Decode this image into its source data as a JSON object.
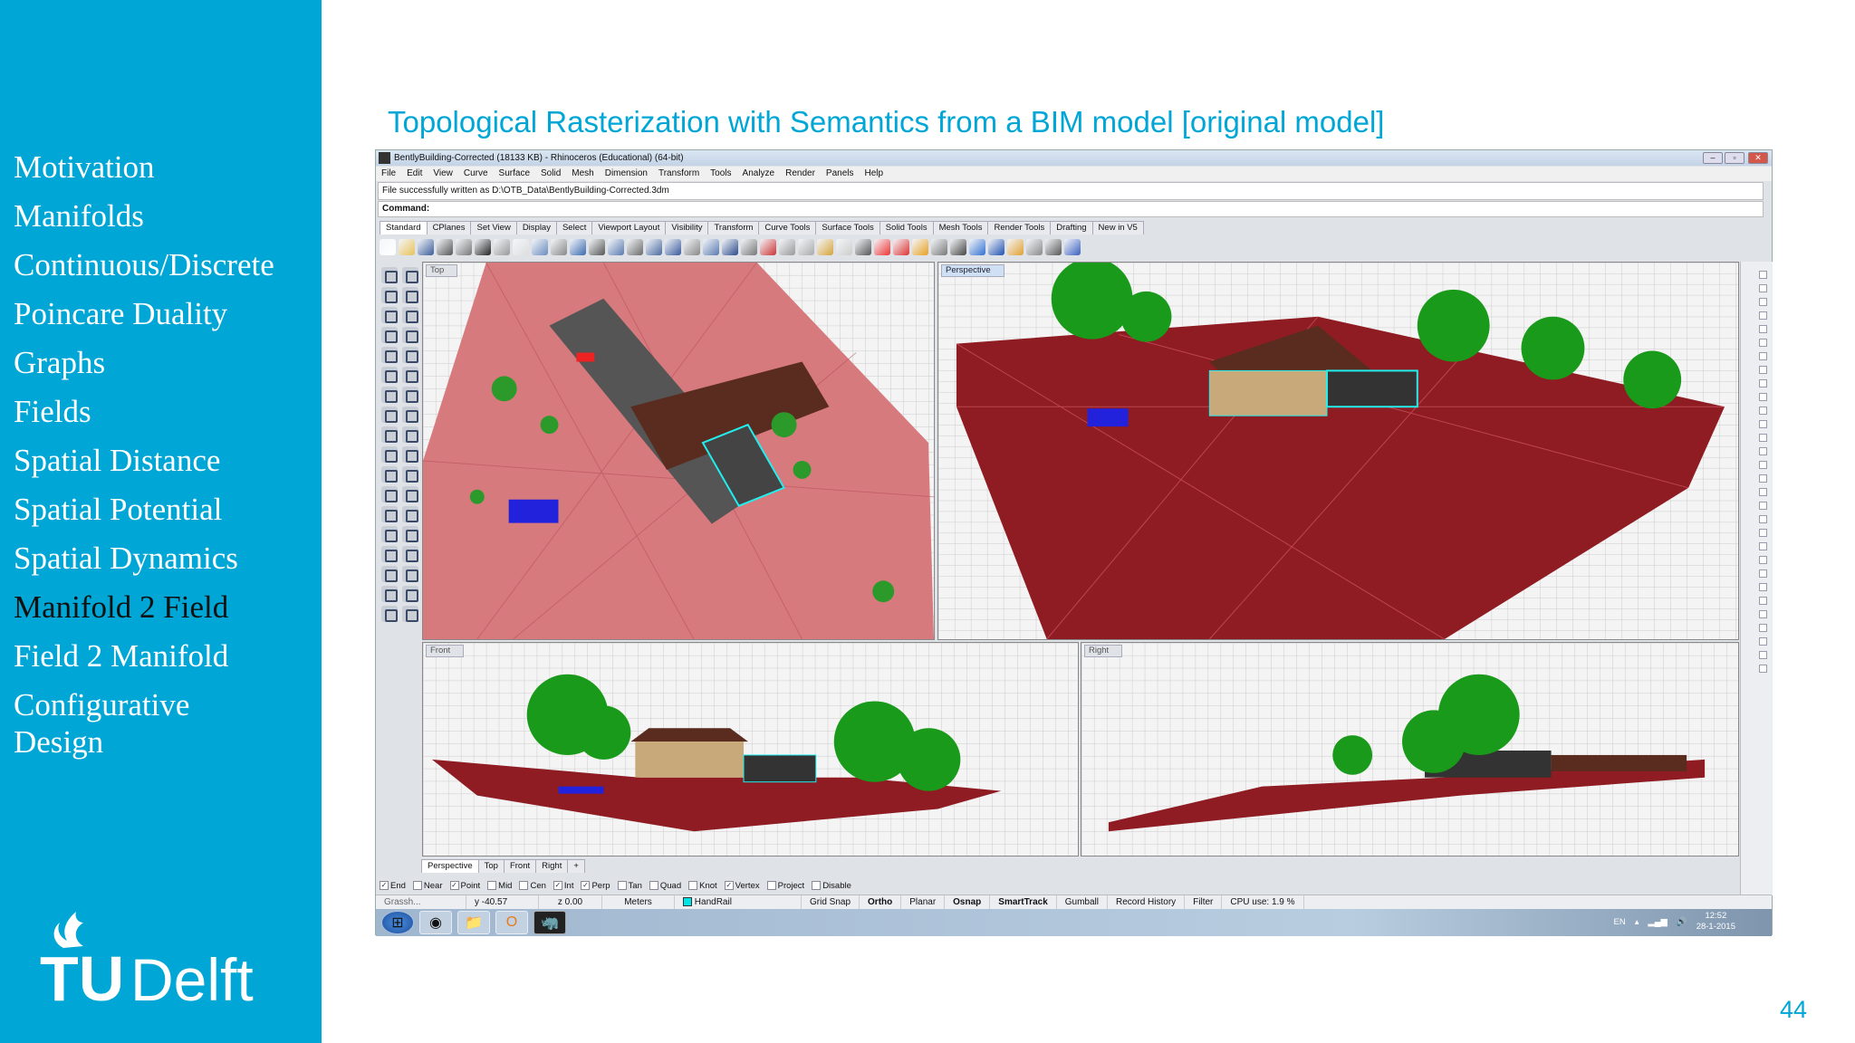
{
  "sidebar": {
    "items": [
      {
        "label": "Motivation"
      },
      {
        "label": "Manifolds"
      },
      {
        "label": "Continuous/Discrete"
      },
      {
        "label": "Poincare Duality"
      },
      {
        "label": "Graphs"
      },
      {
        "label": "Fields"
      },
      {
        "label": "Spatial Distance"
      },
      {
        "label": "Spatial Potential"
      },
      {
        "label": "Spatial Dynamics"
      },
      {
        "label": "Manifold 2 Field",
        "active": true
      },
      {
        "label": "Field 2 Manifold"
      },
      {
        "label": "Configurative Design"
      }
    ],
    "logo_text": "TUDelft"
  },
  "slide": {
    "title": "Topological Rasterization with Semantics from a BIM model [original model]",
    "page_number": "44",
    "accent": "#00a6d6"
  },
  "rhino": {
    "window_title": "BentlyBuilding-Corrected (18133 KB) - Rhinoceros (Educational) (64-bit)",
    "menu": [
      "File",
      "Edit",
      "View",
      "Curve",
      "Surface",
      "Solid",
      "Mesh",
      "Dimension",
      "Transform",
      "Tools",
      "Analyze",
      "Render",
      "Panels",
      "Help"
    ],
    "command_history": "File successfully written as D:\\OTB_Data\\BentlyBuilding-Corrected.3dm",
    "command_label": "Command:",
    "toolbar_tabs": [
      "Standard",
      "CPlanes",
      "Set View",
      "Display",
      "Select",
      "Viewport Layout",
      "Visibility",
      "Transform",
      "Curve Tools",
      "Surface Tools",
      "Solid Tools",
      "Mesh Tools",
      "Render Tools",
      "Drafting",
      "New in V5"
    ],
    "viewports": {
      "top": "Top",
      "perspective": "Perspective",
      "front": "Front",
      "right": "Right"
    },
    "viewport_tabs": [
      "Perspective",
      "Top",
      "Front",
      "Right"
    ],
    "osnaps": [
      {
        "label": "End",
        "checked": true
      },
      {
        "label": "Near",
        "checked": false
      },
      {
        "label": "Point",
        "checked": true
      },
      {
        "label": "Mid",
        "checked": false
      },
      {
        "label": "Cen",
        "checked": false
      },
      {
        "label": "Int",
        "checked": true
      },
      {
        "label": "Perp",
        "checked": true
      },
      {
        "label": "Tan",
        "checked": false
      },
      {
        "label": "Quad",
        "checked": false
      },
      {
        "label": "Knot",
        "checked": false
      },
      {
        "label": "Vertex",
        "checked": true
      },
      {
        "label": "Project",
        "checked": false
      },
      {
        "label": "Disable",
        "checked": false
      }
    ],
    "status": {
      "grasshopper": "Grassh...",
      "y": "y -40.57",
      "z": "z 0.00",
      "units": "Meters",
      "layer": "HandRail",
      "layer_color": "#00e5e5",
      "toggles": [
        "Grid Snap",
        "Ortho",
        "Planar",
        "Osnap",
        "SmartTrack",
        "Gumball",
        "Record History",
        "Filter"
      ],
      "bold_toggles": [
        "Ortho",
        "Osnap",
        "SmartTrack"
      ],
      "cpu": "CPU use: 1.9 %"
    },
    "taskbar": {
      "lang": "EN",
      "time": "12:52",
      "date": "28-1-2015"
    }
  }
}
